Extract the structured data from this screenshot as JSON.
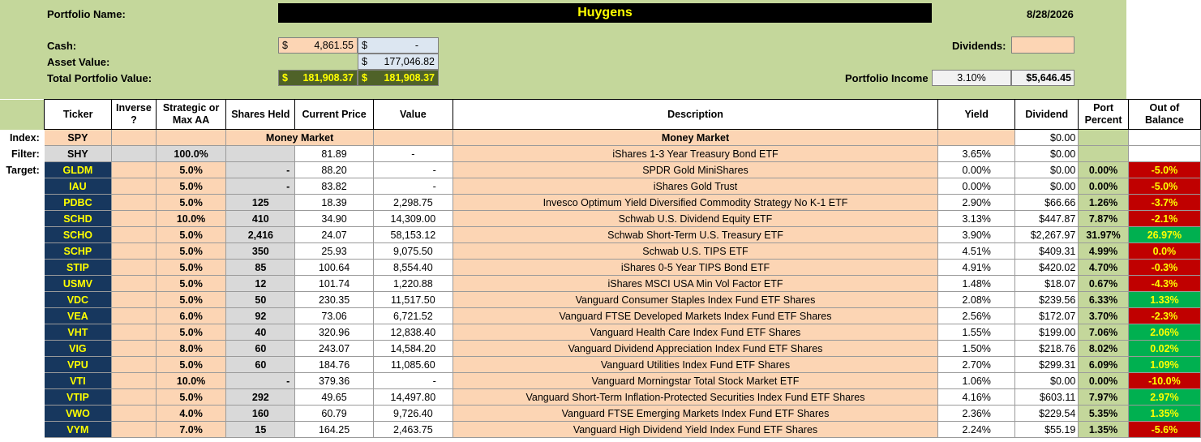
{
  "header": {
    "portfolio_name_label": "Portfolio Name:",
    "portfolio_name": "Huygens",
    "date": "8/28/2026",
    "cash_label": "Cash:",
    "cash_sym1": "$",
    "cash_value": "4,861.55",
    "cash_sym2": "$",
    "cash_value2": "-",
    "asset_label": "Asset Value:",
    "asset_sym": "$",
    "asset_value": "177,046.82",
    "total_label": "Total Portfolio Value:",
    "total_sym1": "$",
    "total_value1": "181,908.37",
    "total_sym2": "$",
    "total_value2": "181,908.37",
    "dividends_label": "Dividends:",
    "income_label": "Portfolio Income",
    "income_pct": "3.10%",
    "income_value": "$5,646.45"
  },
  "columns": [
    "Ticker",
    "Inverse ?",
    "Strategic or Max AA",
    "Shares Held",
    "Current Price",
    "Value",
    "Description",
    "Yield",
    "Dividend",
    "Port Percent",
    "Out of Balance"
  ],
  "index_row": {
    "label": "Index:",
    "ticker": "SPY",
    "money_market_1": "Money Market",
    "money_market_2": "Money Market",
    "dividend": "$0.00"
  },
  "filter_row": {
    "label": "Filter:",
    "ticker": "SHY",
    "aa": "100.0%",
    "price": "81.89",
    "value": "-",
    "description": "iShares 1-3 Year Treasury Bond ETF",
    "yield": "3.65%",
    "dividend": "$0.00"
  },
  "target_label": "Target:",
  "holdings": [
    {
      "ticker": "GLDM",
      "aa": "5.0%",
      "shares": "-",
      "price": "88.20",
      "value": "-",
      "description": "SPDR Gold MiniShares",
      "yield": "0.00%",
      "dividend": "$0.00",
      "port": "0.00%",
      "oob": "-5.0%",
      "oob_color": "red"
    },
    {
      "ticker": "IAU",
      "aa": "5.0%",
      "shares": "-",
      "price": "83.82",
      "value": "-",
      "description": "iShares Gold Trust",
      "yield": "0.00%",
      "dividend": "$0.00",
      "port": "0.00%",
      "oob": "-5.0%",
      "oob_color": "red"
    },
    {
      "ticker": "PDBC",
      "aa": "5.0%",
      "shares": "125",
      "price": "18.39",
      "value": "2,298.75",
      "description": "Invesco Optimum Yield Diversified Commodity Strategy No K-1 ETF",
      "yield": "2.90%",
      "dividend": "$66.66",
      "port": "1.26%",
      "oob": "-3.7%",
      "oob_color": "red"
    },
    {
      "ticker": "SCHD",
      "aa": "10.0%",
      "shares": "410",
      "price": "34.90",
      "value": "14,309.00",
      "description": "Schwab U.S. Dividend Equity ETF",
      "yield": "3.13%",
      "dividend": "$447.87",
      "port": "7.87%",
      "oob": "-2.1%",
      "oob_color": "red"
    },
    {
      "ticker": "SCHO",
      "aa": "5.0%",
      "shares": "2,416",
      "price": "24.07",
      "value": "58,153.12",
      "description": "Schwab Short-Term U.S. Treasury ETF",
      "yield": "3.90%",
      "dividend": "$2,267.97",
      "port": "31.97%",
      "oob": "26.97%",
      "oob_color": "green"
    },
    {
      "ticker": "SCHP",
      "aa": "5.0%",
      "shares": "350",
      "price": "25.93",
      "value": "9,075.50",
      "description": "Schwab U.S. TIPS ETF",
      "yield": "4.51%",
      "dividend": "$409.31",
      "port": "4.99%",
      "oob": "0.0%",
      "oob_color": "red"
    },
    {
      "ticker": "STIP",
      "aa": "5.0%",
      "shares": "85",
      "price": "100.64",
      "value": "8,554.40",
      "description": "iShares 0-5 Year TIPS Bond ETF",
      "yield": "4.91%",
      "dividend": "$420.02",
      "port": "4.70%",
      "oob": "-0.3%",
      "oob_color": "red"
    },
    {
      "ticker": "USMV",
      "aa": "5.0%",
      "shares": "12",
      "price": "101.74",
      "value": "1,220.88",
      "description": "iShares MSCI USA Min Vol Factor ETF",
      "yield": "1.48%",
      "dividend": "$18.07",
      "port": "0.67%",
      "oob": "-4.3%",
      "oob_color": "red"
    },
    {
      "ticker": "VDC",
      "aa": "5.0%",
      "shares": "50",
      "price": "230.35",
      "value": "11,517.50",
      "description": "Vanguard Consumer Staples Index Fund ETF Shares",
      "yield": "2.08%",
      "dividend": "$239.56",
      "port": "6.33%",
      "oob": "1.33%",
      "oob_color": "green"
    },
    {
      "ticker": "VEA",
      "aa": "6.0%",
      "shares": "92",
      "price": "73.06",
      "value": "6,721.52",
      "description": "Vanguard FTSE Developed Markets Index Fund ETF Shares",
      "yield": "2.56%",
      "dividend": "$172.07",
      "port": "3.70%",
      "oob": "-2.3%",
      "oob_color": "red"
    },
    {
      "ticker": "VHT",
      "aa": "5.0%",
      "shares": "40",
      "price": "320.96",
      "value": "12,838.40",
      "description": "Vanguard Health Care Index Fund ETF Shares",
      "yield": "1.55%",
      "dividend": "$199.00",
      "port": "7.06%",
      "oob": "2.06%",
      "oob_color": "green"
    },
    {
      "ticker": "VIG",
      "aa": "8.0%",
      "shares": "60",
      "price": "243.07",
      "value": "14,584.20",
      "description": "Vanguard Dividend Appreciation Index Fund ETF Shares",
      "yield": "1.50%",
      "dividend": "$218.76",
      "port": "8.02%",
      "oob": "0.02%",
      "oob_color": "green"
    },
    {
      "ticker": "VPU",
      "aa": "5.0%",
      "shares": "60",
      "price": "184.76",
      "value": "11,085.60",
      "description": "Vanguard Utilities Index Fund ETF Shares",
      "yield": "2.70%",
      "dividend": "$299.31",
      "port": "6.09%",
      "oob": "1.09%",
      "oob_color": "green"
    },
    {
      "ticker": "VTI",
      "aa": "10.0%",
      "shares": "-",
      "price": "379.36",
      "value": "-",
      "description": "Vanguard Morningstar Total Stock Market ETF",
      "yield": "1.06%",
      "dividend": "$0.00",
      "port": "0.00%",
      "oob": "-10.0%",
      "oob_color": "red"
    },
    {
      "ticker": "VTIP",
      "aa": "5.0%",
      "shares": "292",
      "price": "49.65",
      "value": "14,497.80",
      "description": "Vanguard Short-Term Inflation-Protected Securities Index Fund ETF Shares",
      "yield": "4.16%",
      "dividend": "$603.11",
      "port": "7.97%",
      "oob": "2.97%",
      "oob_color": "green"
    },
    {
      "ticker": "VWO",
      "aa": "4.0%",
      "shares": "160",
      "price": "60.79",
      "value": "9,726.40",
      "description": "Vanguard FTSE Emerging Markets Index Fund ETF Shares",
      "yield": "2.36%",
      "dividend": "$229.54",
      "port": "5.35%",
      "oob": "1.35%",
      "oob_color": "green"
    },
    {
      "ticker": "VYM",
      "aa": "7.0%",
      "shares": "15",
      "price": "164.25",
      "value": "2,463.75",
      "description": "Vanguard High Dividend Yield Index Fund ETF Shares",
      "yield": "2.24%",
      "dividend": "$55.19",
      "port": "1.35%",
      "oob": "-5.6%",
      "oob_color": "red"
    }
  ]
}
